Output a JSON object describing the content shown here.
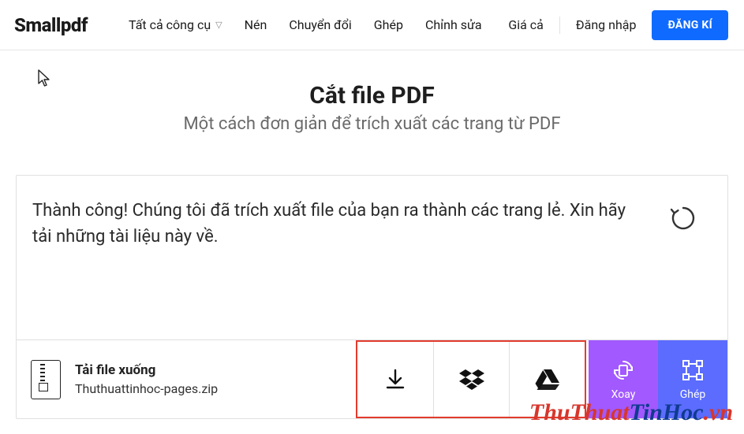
{
  "brand": "Smallpdf",
  "nav": {
    "all_tools": "Tất cả công cụ",
    "compress": "Nén",
    "convert": "Chuyển đổi",
    "merge": "Ghép",
    "edit": "Chỉnh sửa",
    "pricing": "Giá cả",
    "login": "Đăng nhập",
    "signup": "ĐĂNG KÍ"
  },
  "page": {
    "title": "Cắt file PDF",
    "subtitle": "Một cách đơn giản để trích xuất các trang từ PDF"
  },
  "result": {
    "message": "Thành công! Chúng tôi đã trích xuất file của bạn ra thành các trang lẻ. Xin hãy tải những tài liệu này về."
  },
  "download": {
    "title": "Tải file xuống",
    "filename": "Thuthuattinhoc-pages.zip"
  },
  "tools": {
    "rotate": "Xoay",
    "merge": "Ghép"
  },
  "watermark": {
    "part1": "ThuThuat",
    "part2": "TinHoc",
    "suffix": ".vn"
  },
  "colors": {
    "primary": "#0f6bff",
    "highlight_border": "#e33b2e",
    "rotate": "#a259ff",
    "merge": "#5b6cff"
  }
}
